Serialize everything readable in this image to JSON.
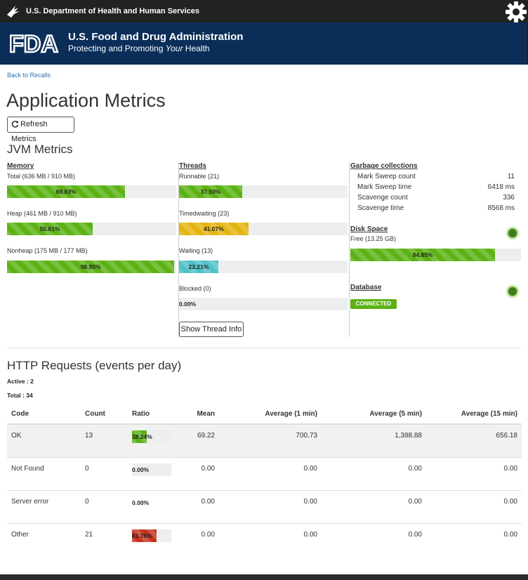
{
  "header": {
    "agency": "U.S. Department of Health and Human Services",
    "fda_title": "U.S. Food and Drug Administration",
    "fda_tagline_pre": "Protecting and Promoting ",
    "fda_tagline_em": "Your",
    "fda_tagline_post": " Health",
    "logo_text": "FDA"
  },
  "nav": {
    "back_link": "Back to Recalls"
  },
  "page": {
    "title": "Application Metrics",
    "refresh_label": "Refresh Metrics",
    "jvm_title": "JVM Metrics"
  },
  "memory": {
    "heading": "Memory",
    "total": {
      "label": "Total (636 MB / 910 MB)",
      "percent_text": "69.83%",
      "fraction": 0.6983
    },
    "heap": {
      "label": "Heap (461 MB / 910 MB)",
      "percent_text": "50.61%",
      "fraction": 0.5061
    },
    "nonheap": {
      "label": "Nonheap (175 MB / 177 MB)",
      "percent_text": "98.95%",
      "fraction": 0.9895
    }
  },
  "threads": {
    "heading": "Threads",
    "runnable": {
      "label": "Runnable (21)",
      "percent_text": "37.50%",
      "fraction": 0.375
    },
    "timedwaiting": {
      "label": "Timedwaiting (23)",
      "percent_text": "41.07%",
      "fraction": 0.4107
    },
    "waiting": {
      "label": "Waiting (13)",
      "percent_text": "23.21%",
      "fraction": 0.2321
    },
    "blocked": {
      "label": "Blocked (0)",
      "percent_text": "0.00%",
      "fraction": 0
    },
    "show_button": "Show Thread Info"
  },
  "gc": {
    "heading": "Garbage collections",
    "rows": [
      {
        "label": "Mark Sweep count",
        "value": "11"
      },
      {
        "label": "Mark Sweep time",
        "value": "6418 ms"
      },
      {
        "label": "Scavenge count",
        "value": "336"
      },
      {
        "label": "Scavenge time",
        "value": "8568 ms"
      }
    ]
  },
  "disk": {
    "heading": "Disk Space",
    "label": "Free (13.25 GB)",
    "percent_text": "84.85%",
    "fraction": 0.8485
  },
  "database": {
    "heading": "Database",
    "status": "CONNECTED"
  },
  "http": {
    "title": "HTTP Requests (events per day)",
    "active": "Active : 2",
    "total": "Total : 34",
    "columns": [
      "Code",
      "Count",
      "Ratio",
      "Mean",
      "Average (1 min)",
      "Average (5 min)",
      "Average (15 min)"
    ],
    "rows": [
      {
        "code": "OK",
        "count": "13",
        "ratio_text": "38.24%",
        "ratio": 0.3824,
        "color": "#5cb214",
        "mean": "69.22",
        "avg1": "700.73",
        "avg5": "1,388.88",
        "avg15": "656.18"
      },
      {
        "code": "Not Found",
        "count": "0",
        "ratio_text": "0.00%",
        "ratio": 0,
        "color": "#5cb214",
        "mean": "0.00",
        "avg1": "0.00",
        "avg5": "0.00",
        "avg15": "0.00"
      },
      {
        "code": "Server error",
        "count": "0",
        "ratio_text": "0.00%",
        "ratio": 0,
        "color": "#5cb214",
        "mean": "0.00",
        "avg1": "0.00",
        "avg5": "0.00",
        "avg15": "0.00"
      },
      {
        "code": "Other",
        "count": "21",
        "ratio_text": "61.76%",
        "ratio": 0.6176,
        "color": "#c7321e",
        "mean": "0.00",
        "avg1": "0.00",
        "avg5": "0.00",
        "avg15": "0.00"
      }
    ]
  },
  "colors": {
    "hhs_bar": "#222222",
    "fda_blue": "#0b2e59",
    "success": "#5cb214",
    "warning": "#e4b410",
    "info": "#4fc1c9",
    "danger": "#c7321e"
  }
}
